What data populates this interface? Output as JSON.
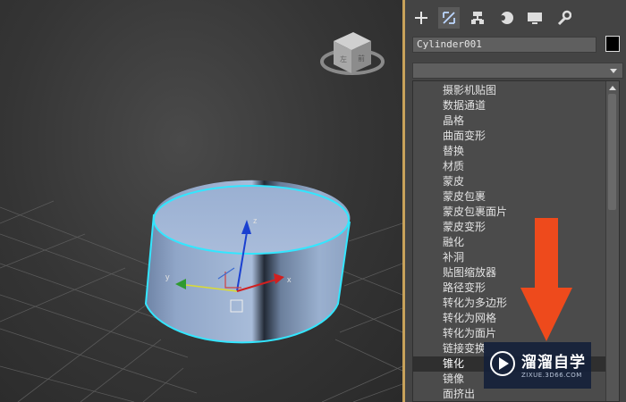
{
  "viewport": {
    "axis_labels": {
      "z": "z",
      "y": "y",
      "x": "x"
    },
    "viewcube": {
      "name": "viewcube"
    }
  },
  "panel": {
    "tabs": [
      {
        "id": "create",
        "icon": "plus-icon"
      },
      {
        "id": "modify",
        "icon": "modify-icon",
        "active": true
      },
      {
        "id": "hierarchy",
        "icon": "hierarchy-icon"
      },
      {
        "id": "motion",
        "icon": "motion-icon"
      },
      {
        "id": "display",
        "icon": "display-icon"
      },
      {
        "id": "utilities",
        "icon": "wrench-icon"
      }
    ],
    "object_name": "Cylinder001",
    "object_color": "#000000",
    "modifier_list_value": "",
    "modifiers": [
      "摄影机贴图",
      "数据通道",
      "晶格",
      "曲面变形",
      "替换",
      "材质",
      "蒙皮",
      "蒙皮包裹",
      "蒙皮包裹面片",
      "蒙皮变形",
      "融化",
      "补洞",
      "贴图缩放器",
      "路径变形",
      "转化为多边形",
      "转化为网格",
      "转化为面片",
      "链接变换",
      "锥化",
      "镜像",
      "面挤出"
    ],
    "selected_modifier": "锥化"
  },
  "annotation": {
    "arrow_color": "#ee4a1c"
  },
  "watermark": {
    "title": "溜溜自学",
    "url": "ZIXUE.3D66.COM"
  },
  "colors": {
    "selection_outline": "#33e6ff",
    "accent": "#c8a25a",
    "cylinder": "#9cb3d8"
  }
}
